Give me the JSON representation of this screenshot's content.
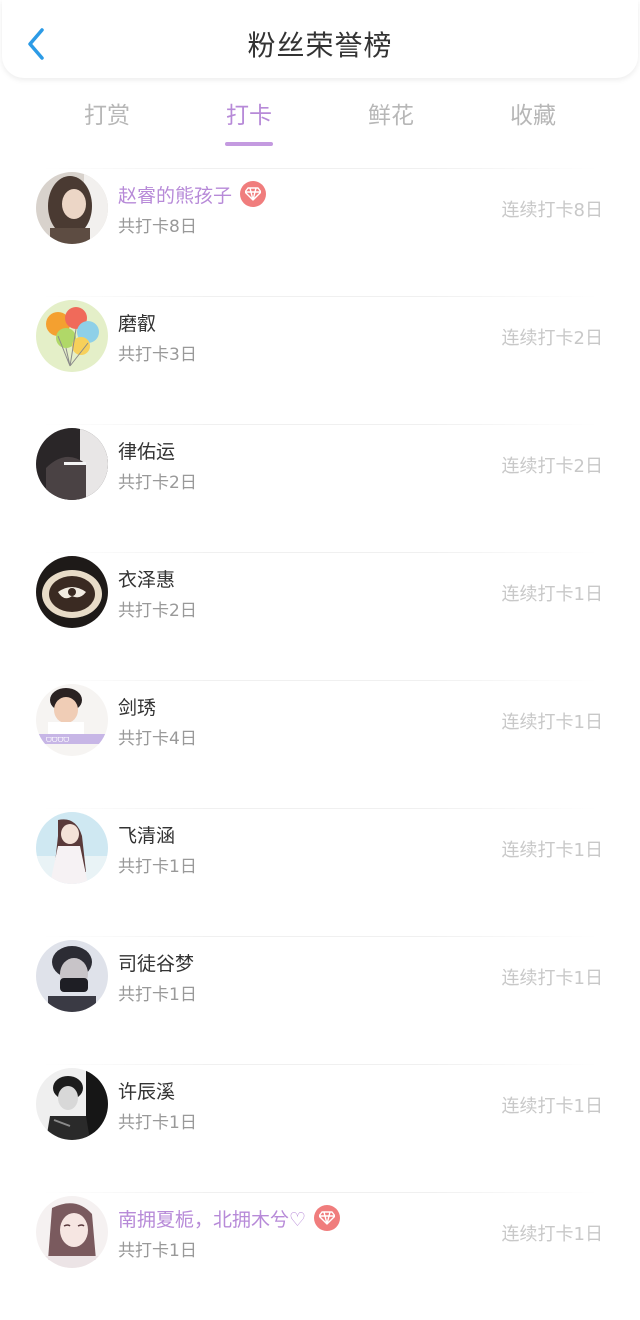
{
  "header": {
    "title": "粉丝荣誉榜"
  },
  "tabs": [
    {
      "label": "打赏",
      "active": false
    },
    {
      "label": "打卡",
      "active": true
    },
    {
      "label": "鲜花",
      "active": false
    },
    {
      "label": "收藏",
      "active": false
    }
  ],
  "colors": {
    "accent": "#b78ad8",
    "badge": "#f07d7d",
    "back": "#2c9be6"
  },
  "fans": [
    {
      "name": "赵睿的熊孩子",
      "vip": true,
      "total": "共打卡8日",
      "streak": "连续打卡8日",
      "avatar_theme": "girl-photo"
    },
    {
      "name": "磨叡",
      "vip": false,
      "total": "共打卡3日",
      "streak": "连续打卡2日",
      "avatar_theme": "balloons"
    },
    {
      "name": "律佑运",
      "vip": false,
      "total": "共打卡2日",
      "streak": "连续打卡2日",
      "avatar_theme": "dark-photo"
    },
    {
      "name": "衣泽惠",
      "vip": false,
      "total": "共打卡2日",
      "streak": "连续打卡1日",
      "avatar_theme": "coffee"
    },
    {
      "name": "剑琇",
      "vip": false,
      "total": "共打卡4日",
      "streak": "连续打卡1日",
      "avatar_theme": "boy-photo"
    },
    {
      "name": "飞清涵",
      "vip": false,
      "total": "共打卡1日",
      "streak": "连续打卡1日",
      "avatar_theme": "anime-girl"
    },
    {
      "name": "司徒谷梦",
      "vip": false,
      "total": "共打卡1日",
      "streak": "连续打卡1日",
      "avatar_theme": "masked-portrait"
    },
    {
      "name": "许辰溪",
      "vip": false,
      "total": "共打卡1日",
      "streak": "连续打卡1日",
      "avatar_theme": "bw-portrait"
    },
    {
      "name": "南拥夏栀，北拥木兮♡",
      "vip": true,
      "total": "共打卡1日",
      "streak": "连续打卡1日",
      "avatar_theme": "sketch-girl"
    }
  ]
}
